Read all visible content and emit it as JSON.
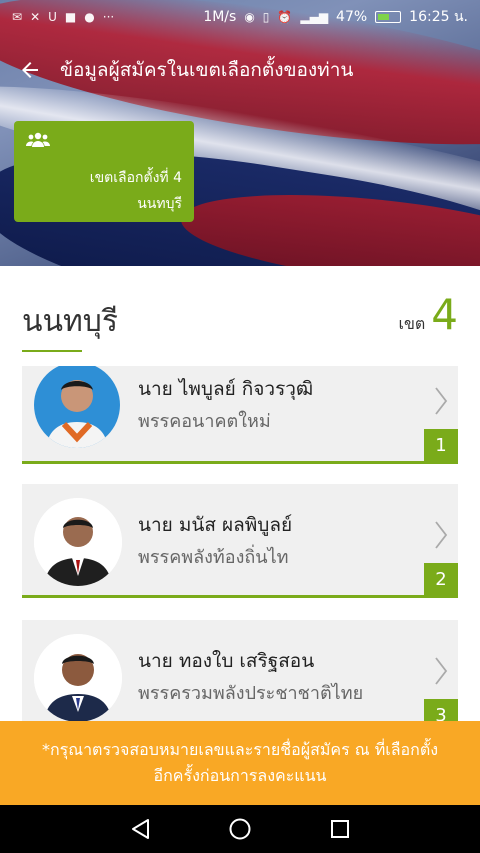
{
  "status": {
    "net_speed": "1M/s",
    "battery": "47%",
    "time": "16:25 น."
  },
  "header": {
    "title": "ข้อมูลผู้สมัครในเขตเลือกตั้งของท่าน"
  },
  "zone_card": {
    "zone_text": "เขตเลือกตั้งที่ 4",
    "province": "นนทบุรี"
  },
  "section": {
    "province": "นนทบุรี",
    "zone_label": "เขต",
    "zone_number": "4"
  },
  "candidates": [
    {
      "name": "นาย ไพบูลย์ กิจวรวุฒิ",
      "party": "พรรคอนาคตใหม่",
      "number": "1"
    },
    {
      "name": "นาย มนัส ผลพิบูลย์",
      "party": "พรรคพลังท้องถิ่นไท",
      "number": "2"
    },
    {
      "name": "นาย ทองใบ เสริฐสอน",
      "party": "พรรครวมพลังประชาชาติไทย",
      "number": "3"
    }
  ],
  "notice": {
    "line1": "*กรุณาตรวจสอบหมายเลขและรายชื่อผู้สมัคร ณ ที่เลือกตั้ง",
    "line2": "อีกครั้งก่อนการลงคะแนน"
  },
  "colors": {
    "accent_green": "#7aab1a",
    "notice_orange": "#f9a825"
  }
}
